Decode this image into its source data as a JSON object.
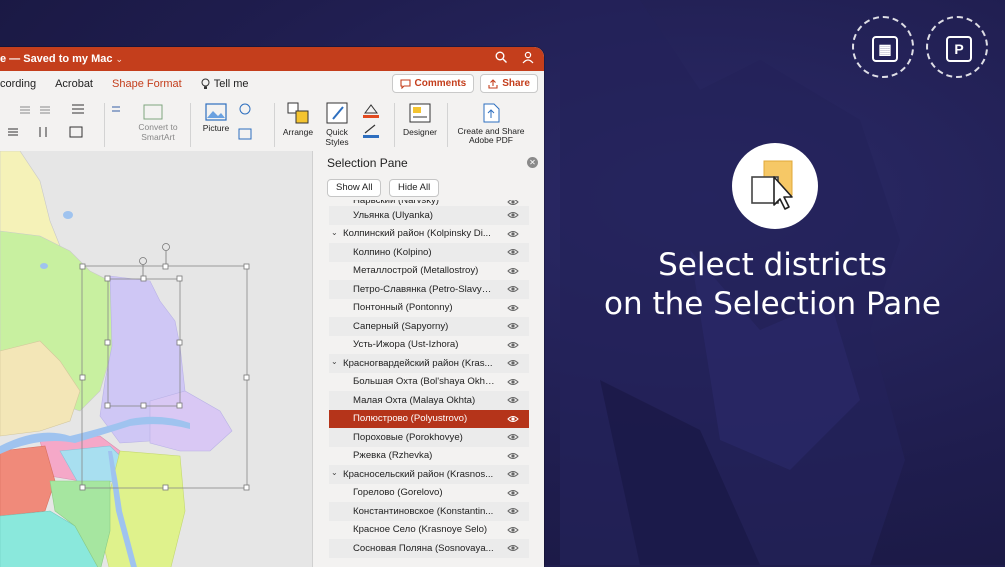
{
  "window": {
    "title": "e — Saved to my Mac",
    "tabs": [
      "cording",
      "Acrobat",
      "Shape Format",
      "Tell me"
    ],
    "active_tab": "Shape Format",
    "comments_label": "Comments",
    "share_label": "Share"
  },
  "ribbon": {
    "convert_smartart": "Convert to SmartArt",
    "picture": "Picture",
    "arrange": "Arrange",
    "quick_styles": "Quick Styles",
    "designer": "Designer",
    "adobe_pdf": "Create and Share Adobe PDF"
  },
  "pane": {
    "title": "Selection Pane",
    "show_all": "Show All",
    "hide_all": "Hide All",
    "items": [
      {
        "label": "Нарвский (Narvsky)",
        "level": "child"
      },
      {
        "label": "Ульянка (Ulyanka)",
        "level": "child"
      },
      {
        "label": "Колпинский район (Kolpinsky Di...",
        "level": "parent"
      },
      {
        "label": "Колпино (Kolpino)",
        "level": "child"
      },
      {
        "label": "Металлострой (Metallostroy)",
        "level": "child"
      },
      {
        "label": "Петро-Славянка (Petro-Slavya...",
        "level": "child"
      },
      {
        "label": "Понтонный (Pontonny)",
        "level": "child"
      },
      {
        "label": "Саперный (Sapyorny)",
        "level": "child"
      },
      {
        "label": "Усть-Ижора (Ust-Izhora)",
        "level": "child"
      },
      {
        "label": "Красногвардейский район (Kras...",
        "level": "parent"
      },
      {
        "label": "Большая Охта (Bol'shaya Okhta)",
        "level": "child"
      },
      {
        "label": "Малая Охта (Malaya Okhta)",
        "level": "child"
      },
      {
        "label": "Полюстрово (Polyustrovo)",
        "level": "child",
        "selected": true
      },
      {
        "label": "Пороховые (Porokhovye)",
        "level": "child"
      },
      {
        "label": "Ржевка (Rzhevka)",
        "level": "child"
      },
      {
        "label": "Красносельский район (Krasnos...",
        "level": "parent"
      },
      {
        "label": "Горелово (Gorelovo)",
        "level": "child"
      },
      {
        "label": "Константиновское (Konstantin...",
        "level": "child"
      },
      {
        "label": "Красное Село (Krasnoye Selo)",
        "level": "child"
      },
      {
        "label": "Сосновая Поляна (Sosnovaya...",
        "level": "child"
      }
    ]
  },
  "promo": {
    "line1": "Select districts",
    "line2": "on the Selection Pane"
  },
  "colors": {
    "accent": "#c43e1c",
    "selected_row": "#b5341a",
    "background": "#1f1d4e"
  }
}
